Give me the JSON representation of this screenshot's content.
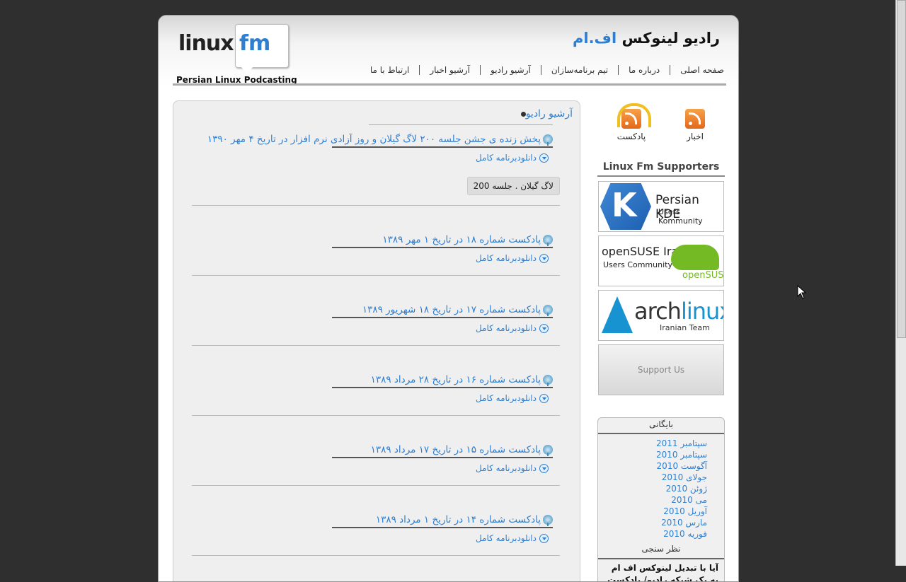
{
  "header": {
    "logo_text": "linux",
    "logo_fm": "fm",
    "logo_sub": "Persian Linux Podcasting",
    "brand_main": "رادیو لینوکس",
    "brand_accent": "اف.ام",
    "nav": [
      "صفحه اصلی",
      "درباره ما",
      "تیم برنامه‌سازان",
      "آرشیو رادیو",
      "آرشیو اخبار",
      "ارتباط با ما"
    ]
  },
  "content": {
    "section_title": "آرشیو رادیو",
    "download_label": "دانلودبرنامه کامل",
    "posts": [
      {
        "title": "پخش زنده ی جشن جلسه ۲۰۰ لاگ گیلان و روز آزادی نرم افزار در تاریخ ۴ مهر ۱۳۹۰",
        "tag": "لاگ گیلان . جلسه 200"
      },
      {
        "title": "پادکست شماره ۱۸ در تاریخ ۱ مهر ۱۳۸۹"
      },
      {
        "title": "پادکست شماره ۱۷ در تاریخ ۱۸ شهریور ۱۳۸۹"
      },
      {
        "title": "پادکست شماره ۱۶ در تاریخ ۲۸ مرداد ۱۳۸۹"
      },
      {
        "title": "پادکست شماره ۱۵ در تاریخ ۱۷ مرداد ۱۳۸۹"
      },
      {
        "title": "پادکست شماره ۱۴ در تاریخ ۱ مرداد ۱۳۸۹"
      }
    ]
  },
  "sidebar": {
    "feed_news": "اخبار",
    "feed_podcast": "پادکست",
    "supporters_title": "Linux Fm Supporters",
    "banners": {
      "kde_line1": "Persian KDE",
      "kde_line2": "Users Kommunity",
      "suse_line1": "openSUSE Iran",
      "suse_line2": "Users Community",
      "suse_line3": "openSUSE",
      "arch_a": "arch",
      "arch_b": "linux",
      "arch_team": "Iranian Team",
      "support": "Support Us"
    },
    "archive_title": "بایگانی",
    "archive": [
      "سپتامبر 2011",
      "سپتامبر 2010",
      "آگوست 2010",
      "جولای 2010",
      "ژوئن 2010",
      "می 2010",
      "آوریل 2010",
      "مارس 2010",
      "فوریه 2010"
    ],
    "poll_title": "نظر سنجی",
    "poll_question": "آیا با تبدیل لینوکس اف ام به یک شبکه رادیو/ پادکست چندرسانه‌ای موافق هستید؟"
  }
}
